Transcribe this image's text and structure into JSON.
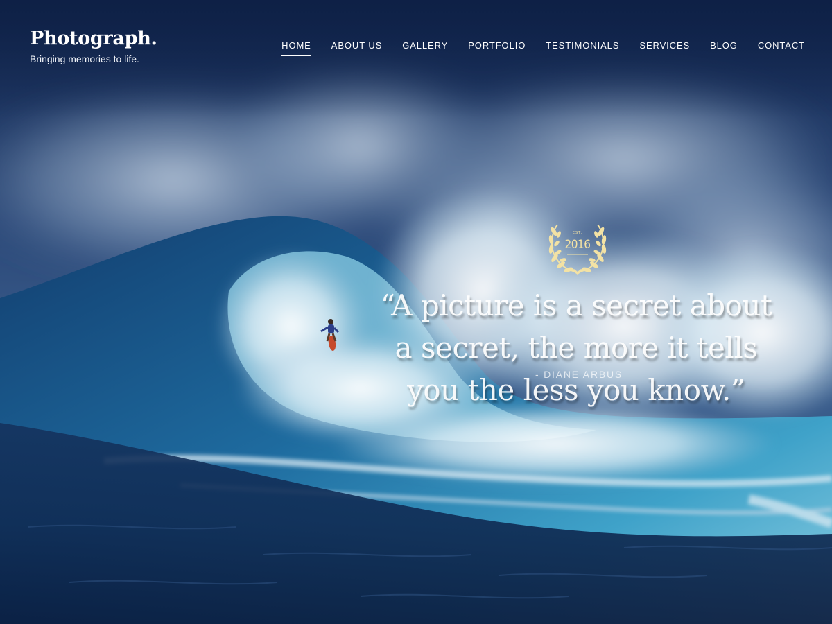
{
  "header": {
    "brand_name": "Photograph.",
    "tagline": "Bringing memories to life."
  },
  "nav": {
    "items": [
      {
        "label": "HOME",
        "active": true
      },
      {
        "label": "ABOUT US",
        "active": false
      },
      {
        "label": "GALLERY",
        "active": false
      },
      {
        "label": "PORTFOLIO",
        "active": false
      },
      {
        "label": "TESTIMONIALS",
        "active": false
      },
      {
        "label": "SERVICES",
        "active": false
      },
      {
        "label": "BLOG",
        "active": false
      },
      {
        "label": "CONTACT",
        "active": false
      }
    ]
  },
  "hero": {
    "badge": {
      "est": "EST.",
      "year": "2016"
    },
    "quote_lines": [
      "“A picture is a secret about",
      "a secret, the more it tells",
      "you the less you know.”"
    ],
    "quote_author": "- DIANE ARBUS"
  },
  "colors": {
    "badge_gold": "#f3e2a4",
    "text": "#ffffff",
    "sea_dark": "#0b1d3c"
  },
  "icons": {
    "badge": "laurel-wreath-icon"
  }
}
